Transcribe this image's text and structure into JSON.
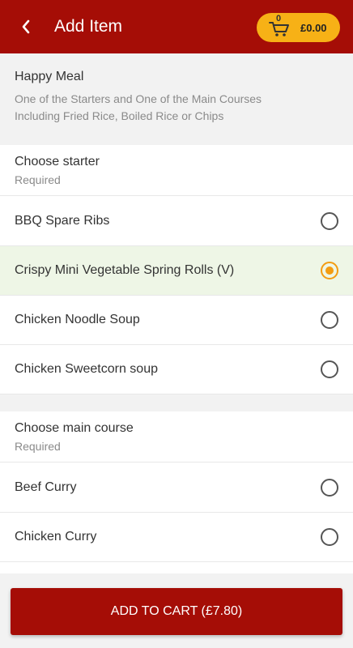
{
  "header": {
    "title": "Add Item",
    "back_icon": "chevron-left-icon",
    "cart": {
      "count": "0",
      "total": "£0.00",
      "icon": "cart-icon"
    }
  },
  "colors": {
    "brand": "#a50d06",
    "accent": "#f7b116",
    "selected_bg": "#eef6e6",
    "radio_selected": "#f39c12"
  },
  "meal": {
    "name": "Happy Meal",
    "description_line1": "One of the Starters and One of the Main Courses",
    "description_line2": "Including Fried Rice, Boiled Rice or Chips"
  },
  "starter": {
    "title": "Choose starter",
    "subtitle": "Required",
    "options": [
      {
        "label": "BBQ Spare Ribs",
        "selected": false
      },
      {
        "label": "Crispy Mini Vegetable Spring Rolls (V)",
        "selected": true
      },
      {
        "label": "Chicken Noodle Soup",
        "selected": false
      },
      {
        "label": "Chicken Sweetcorn soup",
        "selected": false
      }
    ]
  },
  "main": {
    "title": "Choose main course",
    "subtitle": "Required",
    "options": [
      {
        "label": "Beef Curry",
        "selected": false
      },
      {
        "label": "Chicken Curry",
        "selected": false
      }
    ]
  },
  "footer": {
    "add_to_cart_label": "ADD TO CART  (£7.80)"
  }
}
